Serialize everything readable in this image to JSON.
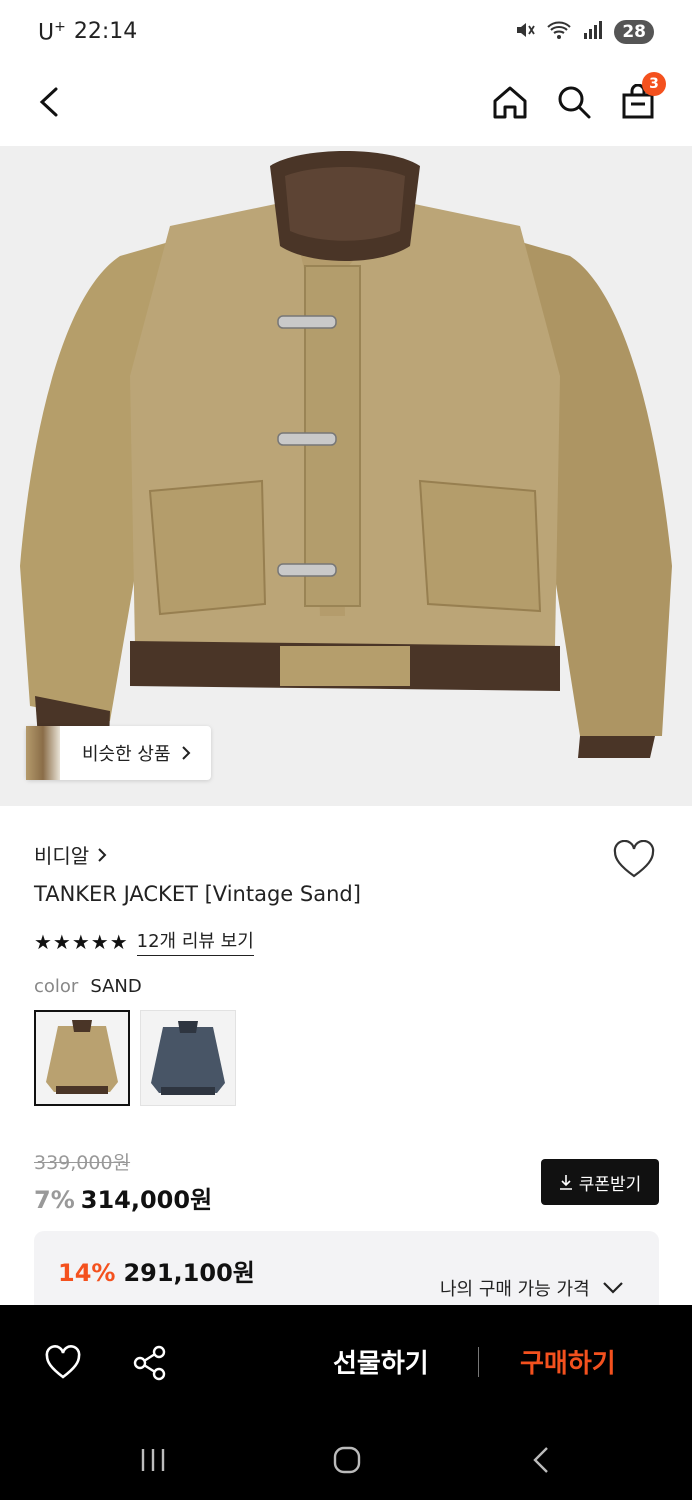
{
  "status_bar": {
    "carrier": "U",
    "carrier_sup": "+",
    "time": "22:14",
    "battery": "28"
  },
  "header": {
    "cart_badge": "3"
  },
  "hero": {
    "similar_label": "비슷한 상품"
  },
  "product": {
    "brand": "비디알",
    "name": "TANKER JACKET [Vintage Sand]",
    "stars": "★★★★★",
    "review_link": "12개 리뷰 보기",
    "color_label": "color",
    "color_value": "SAND"
  },
  "price": {
    "original": "339,000원",
    "discount_pct": "7%",
    "sale": "314,000원",
    "coupon_button": "쿠폰받기",
    "best_pct": "14%",
    "best_price": "291,100원",
    "my_price_label": "나의 구매 가능 가격"
  },
  "bottom_bar": {
    "gift": "선물하기",
    "buy": "구매하기"
  },
  "colors": {
    "accent": "#f4511e",
    "dark": "#000000"
  }
}
